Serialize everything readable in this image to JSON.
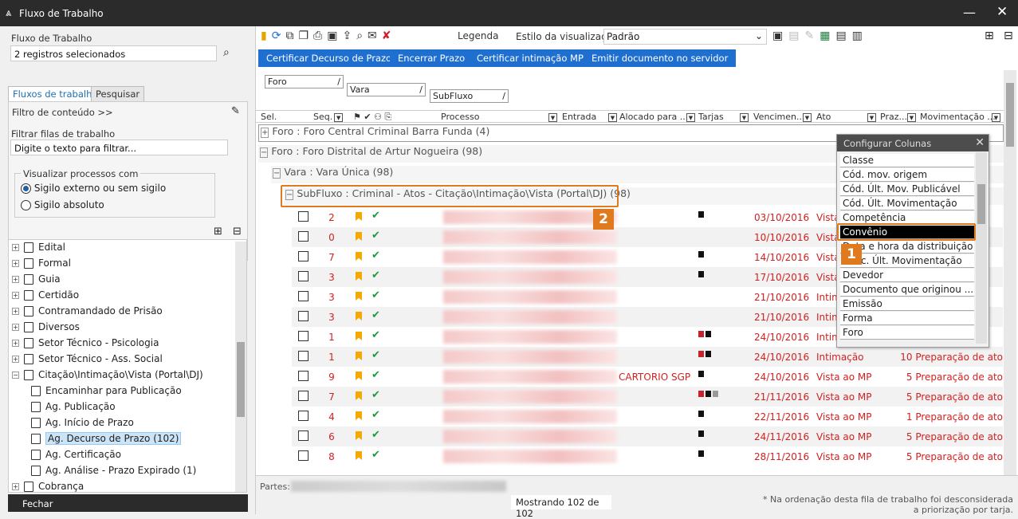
{
  "window": {
    "title": "Fluxo de Trabalho",
    "minimize": "—",
    "close": "✕"
  },
  "left": {
    "fluxo_label": "Fluxo de Trabalho",
    "fluxo_value": "2 registros selecionados",
    "tabs": [
      "Fluxos de trabalho",
      "Pesquisar"
    ],
    "filtro_conteudo": "Filtro de conteúdo >>",
    "filtrar_label": "Filtrar filas de trabalho",
    "filtrar_placeholder": "Digite o texto para filtrar...",
    "visualizar_label": "Visualizar processos com",
    "radios": [
      "Sigilo externo ou sem sigilo",
      "Sigilo absoluto"
    ],
    "tree": [
      {
        "label": "Edital",
        "level": 0,
        "toggle": "+"
      },
      {
        "label": "Formal",
        "level": 0,
        "toggle": "+"
      },
      {
        "label": "Guia",
        "level": 0,
        "toggle": "+"
      },
      {
        "label": "Certidão",
        "level": 0,
        "toggle": "+"
      },
      {
        "label": "Contramandado de Prisão",
        "level": 0,
        "toggle": "+"
      },
      {
        "label": "Diversos",
        "level": 0,
        "toggle": "+"
      },
      {
        "label": "Setor Técnico - Psicologia",
        "level": 0,
        "toggle": "+"
      },
      {
        "label": "Setor Técnico - Ass. Social",
        "level": 0,
        "toggle": "+"
      },
      {
        "label": "Citação\\Intimação\\Vista (Portal\\DJ)",
        "level": 0,
        "toggle": "−"
      },
      {
        "label": "Encaminhar para Publicação",
        "level": 1
      },
      {
        "label": "Ag. Publicação",
        "level": 1
      },
      {
        "label": "Ag. Início de Prazo",
        "level": 1
      },
      {
        "label": "Ag. Decurso de Prazo (102)",
        "level": 1,
        "selected": true
      },
      {
        "label": "Ag. Certificação",
        "level": 1
      },
      {
        "label": "Ag. Análise - Prazo Expirado (1)",
        "level": 1
      },
      {
        "label": "Cobrança",
        "level": 0,
        "toggle": "+"
      }
    ],
    "fechar": "Fechar"
  },
  "toolbar": {
    "legenda": "Legenda",
    "estilo_label": "Estilo da visualização",
    "estilo_value": "Padrão"
  },
  "actions": [
    "Certificar Decurso de Prazo",
    "Encerrar Prazo",
    "Certificar intimação MP",
    "Emitir documento no servidor"
  ],
  "grouping": [
    "Foro",
    "Vara",
    "SubFluxo"
  ],
  "columns": [
    "Sel.",
    "Seq.",
    "Processo",
    "Entrada",
    "Alocado para ...",
    "Tarjas",
    "Vencimen...",
    "Ato",
    "Praz...",
    "Movimentação ..."
  ],
  "groups": {
    "g1": "Foro : Foro Central Criminal Barra Funda  (4)",
    "g2": "Foro : Foro Distrital de Artur Nogueira  (98)",
    "g3": "Vara : Vara Única  (98)",
    "g4": "SubFluxo : Criminal - Atos - Citação\\Intimação\\Vista (Portal\\DJ)  (98)"
  },
  "rows": [
    {
      "seq": "2",
      "date": "03/10/2016",
      "ato": "Vista",
      "mov": "",
      "tarjas": [
        "#111"
      ],
      "chk": true,
      "aloc": ""
    },
    {
      "seq": "0",
      "date": "10/10/2016",
      "ato": "Vista",
      "mov": "",
      "tarjas": [],
      "chk": true,
      "aloc": ""
    },
    {
      "seq": "7",
      "date": "14/10/2016",
      "ato": "Vista",
      "mov": "",
      "tarjas": [
        "#111"
      ],
      "chk": true,
      "aloc": ""
    },
    {
      "seq": "3",
      "date": "17/10/2016",
      "ato": "Vista",
      "mov": "",
      "tarjas": [
        "#111"
      ],
      "chk": true,
      "aloc": ""
    },
    {
      "seq": "3",
      "date": "21/10/2016",
      "ato": "Intim",
      "mov": "",
      "tarjas": [],
      "chk": true,
      "aloc": ""
    },
    {
      "seq": "3",
      "date": "21/10/2016",
      "ato": "Intim",
      "mov": "",
      "tarjas": [],
      "chk": true,
      "aloc": ""
    },
    {
      "seq": "1",
      "date": "24/10/2016",
      "ato": "Intim",
      "mov": "",
      "tarjas": [
        "#c8232c",
        "#111"
      ],
      "chk": true,
      "aloc": ""
    },
    {
      "seq": "1",
      "date": "24/10/2016",
      "ato": "Intimação",
      "mov": "10 Preparação de ato",
      "tarjas": [
        "#c8232c",
        "#111"
      ],
      "chk": true,
      "aloc": ""
    },
    {
      "seq": "9",
      "date": "24/10/2016",
      "ato": "Vista ao MP",
      "mov": "5 Preparação de ato",
      "tarjas": [
        "#111"
      ],
      "chk": true,
      "aloc": "CARTORIO SGP"
    },
    {
      "seq": "7",
      "date": "21/11/2016",
      "ato": "Vista ao MP",
      "mov": "5 Preparação de ato",
      "tarjas": [
        "#c8232c",
        "#111",
        "#999"
      ],
      "chk": true,
      "aloc": ""
    },
    {
      "seq": "4",
      "date": "22/11/2016",
      "ato": "Vista ao MP",
      "mov": "1 Preparação de ato",
      "tarjas": [
        "#111"
      ],
      "chk": true,
      "aloc": ""
    },
    {
      "seq": "6",
      "date": "24/11/2016",
      "ato": "Vista ao MP",
      "mov": "5 Preparação de ato",
      "tarjas": [
        "#111"
      ],
      "chk": true,
      "aloc": ""
    },
    {
      "seq": "8",
      "date": "28/11/2016",
      "ato": "Vista ao MP",
      "mov": "5 Preparação de ato",
      "tarjas": [
        "#111"
      ],
      "chk": true,
      "aloc": ""
    }
  ],
  "popup": {
    "title": "Configurar Colunas",
    "items": [
      "Classe",
      "Cód. mov. origem",
      "Cód. Últ. Mov. Publicável",
      "Cód. Últ. Movimentação",
      "Competência",
      "Convênio",
      "Data e hora da distribuição",
      "Desc. Últ. Movimentação",
      "Devedor",
      "Documento que originou ...",
      "Emissão",
      "Forma",
      "Foro"
    ],
    "selected_index": 5
  },
  "callouts": {
    "one": "1",
    "two": "2"
  },
  "footer": {
    "partes": "Partes:",
    "mostrando": "Mostrando 102 de 102",
    "note1": "* Na ordenação desta fila de trabalho foi desconsiderada",
    "note2": "a priorização por tarja."
  },
  "colors": {
    "accent": "#1f6fd1",
    "callout": "#e07a1f",
    "danger": "#d32020"
  }
}
